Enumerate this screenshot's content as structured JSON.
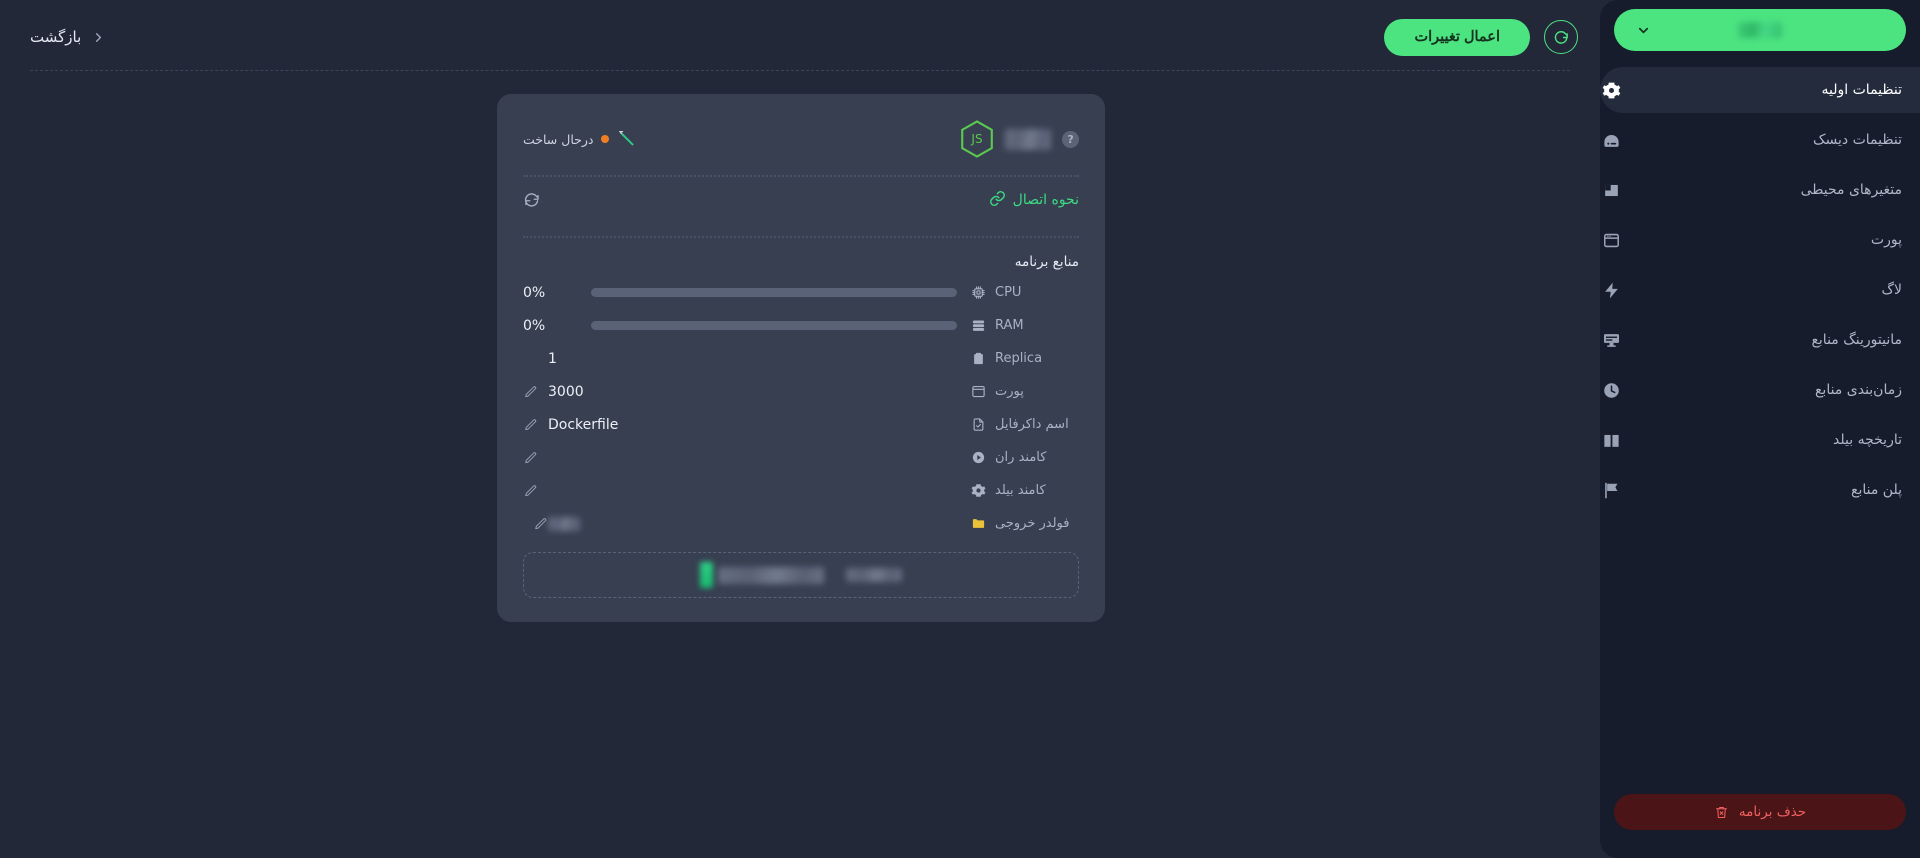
{
  "topbar": {
    "apply_label": "اعمال تغییرات",
    "refresh_icon": "refresh-icon",
    "back_label": "بازگشت",
    "back_chevron_icon": "chevron-left-icon"
  },
  "card": {
    "runtime_icon": "nodejs-js-logo",
    "app_name": "",
    "help_icon": "question-mark-icon",
    "status_icon": "pickaxe-icon",
    "status_dot_color": "#f07f22",
    "status_text": "درحال ساخت",
    "connect_label": "نحوه اتصال",
    "connect_icon": "link-icon",
    "card_refresh_icon": "refresh-icon",
    "resources_title": "منابع برنامه",
    "resources": [
      {
        "icon": "cpu-chip-icon",
        "label": "CPU",
        "value": "0%",
        "percent": 0,
        "has_bar": true
      },
      {
        "icon": "ram-server-icon",
        "label": "RAM",
        "value": "0%",
        "percent": 0,
        "has_bar": true
      },
      {
        "icon": "clipboard-icon",
        "label": "Replica",
        "value": "1",
        "has_bar": false
      }
    ],
    "details": [
      {
        "icon": "window-icon",
        "label": "پورت",
        "value": "3000",
        "editable": true
      },
      {
        "icon": "document-check-icon",
        "label": "اسم داکرفایل",
        "value": "Dockerfile",
        "editable": true
      },
      {
        "icon": "play-circle-icon",
        "label": "کامند ران",
        "value": "",
        "editable": true
      },
      {
        "icon": "gear-icon",
        "label": "کامند بیلد",
        "value": "",
        "editable": true
      },
      {
        "icon": "folder-icon",
        "label": "فولدر خروجی",
        "value": "",
        "editable": true,
        "blurred_value": true
      }
    ],
    "edit_icon": "pencil-edit-icon",
    "footer_actions": [
      {
        "name": "primary-action",
        "blurred": true
      },
      {
        "name": "secondary-action",
        "blurred": true
      }
    ]
  },
  "sidebar": {
    "project_selector": {
      "value": "",
      "chevron_icon": "chevron-down-icon"
    },
    "items": [
      {
        "icon": "gear-icon",
        "label": "تنظیمات اولیه",
        "active": true
      },
      {
        "icon": "disk-icon",
        "label": "تنظیمات دیسک",
        "active": false
      },
      {
        "icon": "env-block-icon",
        "label": "متغیرهای محیطی",
        "active": false
      },
      {
        "icon": "window-port-icon",
        "label": "پورت",
        "active": false
      },
      {
        "icon": "bolt-icon",
        "label": "لاگ",
        "active": false
      },
      {
        "icon": "monitor-icon",
        "label": "مانیتورینگ منابع",
        "active": false
      },
      {
        "icon": "clock-icon",
        "label": "زمان‌بندی منابع",
        "active": false
      },
      {
        "icon": "book-icon",
        "label": "تاریخچه بیلد",
        "active": false
      },
      {
        "icon": "flag-icon",
        "label": "پلن منابع",
        "active": false
      }
    ],
    "delete_button": {
      "label": "حذف برنامه",
      "icon": "trash-x-icon"
    }
  },
  "colors": {
    "accent_green": "#4ce381",
    "page_bg": "#222838",
    "card_bg": "#373f51",
    "sidebar_bg": "#161c2b",
    "danger": "#f06060",
    "status_orange": "#f07f22",
    "folder_yellow": "#ecc23a"
  }
}
